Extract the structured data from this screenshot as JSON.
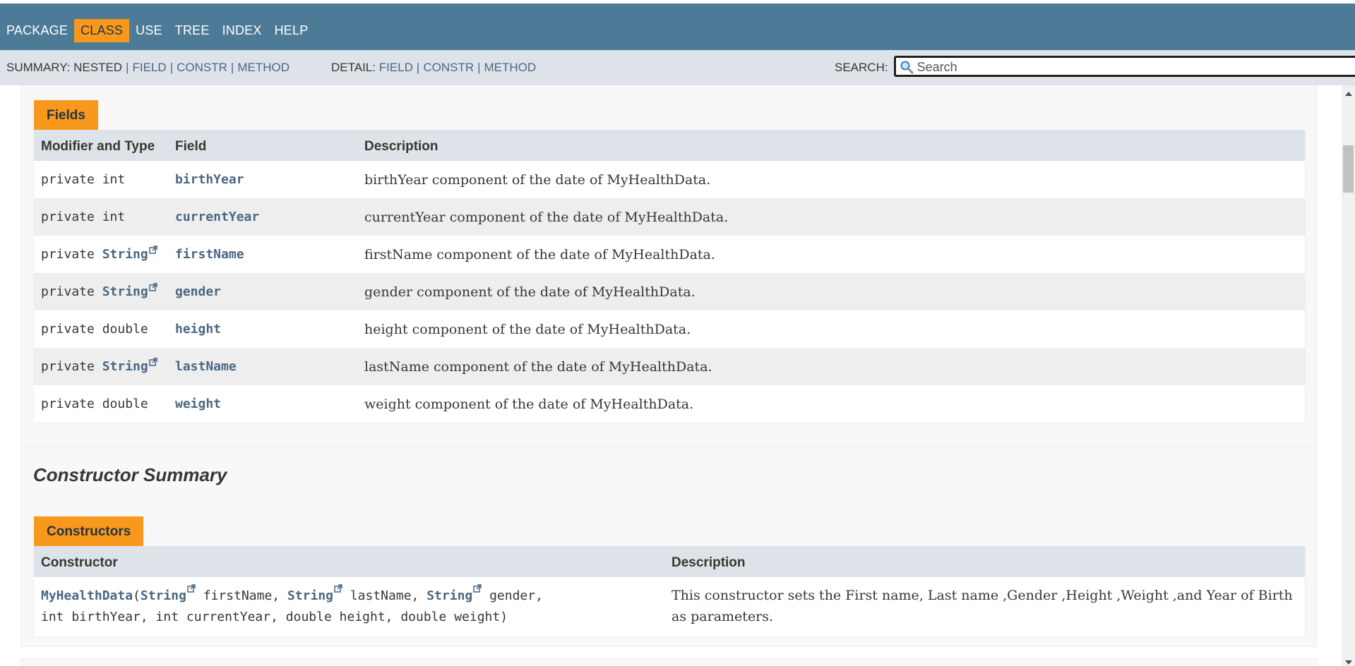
{
  "topnav": {
    "items": [
      {
        "label": "PACKAGE",
        "active": false
      },
      {
        "label": "CLASS",
        "active": true
      },
      {
        "label": "USE",
        "active": false
      },
      {
        "label": "TREE",
        "active": false
      },
      {
        "label": "INDEX",
        "active": false
      },
      {
        "label": "HELP",
        "active": false
      }
    ]
  },
  "subnav": {
    "summary_label": "SUMMARY:",
    "summary_nested": "NESTED",
    "summary_field": "FIELD",
    "summary_constr": "CONSTR",
    "summary_method": "METHOD",
    "separator": "|",
    "detail_label": "DETAIL:",
    "detail_field": "FIELD",
    "detail_constr": "CONSTR",
    "detail_method": "METHOD"
  },
  "search": {
    "label": "SEARCH:",
    "placeholder": "Search",
    "value": ""
  },
  "fields": {
    "caption": "Fields",
    "headers": {
      "modifier": "Modifier and Type",
      "field": "Field",
      "description": "Description"
    },
    "rows": [
      {
        "modifier": "private int",
        "type_link": "",
        "name": "birthYear",
        "description": "birthYear component of the date of MyHealthData."
      },
      {
        "modifier": "private int",
        "type_link": "",
        "name": "currentYear",
        "description": "currentYear component of the date of MyHealthData."
      },
      {
        "modifier": "private",
        "type_link": "String",
        "name": "firstName",
        "description": "firstName component of the date of MyHealthData."
      },
      {
        "modifier": "private",
        "type_link": "String",
        "name": "gender",
        "description": "gender component of the date of MyHealthData."
      },
      {
        "modifier": "private double",
        "type_link": "",
        "name": "height",
        "description": "height component of the date of MyHealthData."
      },
      {
        "modifier": "private",
        "type_link": "String",
        "name": "lastName",
        "description": "lastName component of the date of MyHealthData."
      },
      {
        "modifier": "private double",
        "type_link": "",
        "name": "weight",
        "description": "weight component of the date of MyHealthData."
      }
    ]
  },
  "constructors": {
    "section_title": "Constructor Summary",
    "caption": "Constructors",
    "headers": {
      "constructor": "Constructor",
      "description": "Description"
    },
    "signature": {
      "name": "MyHealthData",
      "open_paren": "(",
      "type1": "String",
      "param1": " firstName, ",
      "type2": "String",
      "param2": " lastName, ",
      "type3": "String",
      "param3": " gender,",
      "line2": "int birthYear, int currentYear, double height, double weight)"
    },
    "description": "This constructor sets the First name, Last name ,Gender ,Height ,Weight ,and Year of Birth as parameters."
  },
  "icons": {
    "search": "search-icon",
    "clear": "close-icon",
    "external_link": "external-link-icon"
  },
  "colors": {
    "header_bg": "#4d7a97",
    "subnav_bg": "#dee3e9",
    "accent": "#f8981d",
    "link": "#4a6782"
  }
}
